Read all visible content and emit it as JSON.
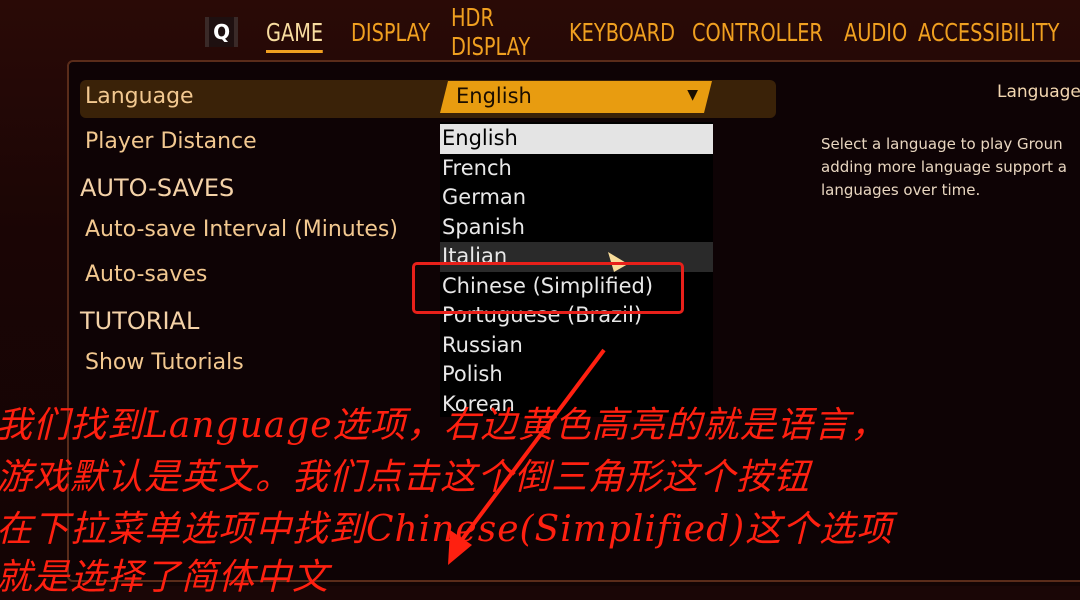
{
  "tabs": {
    "hotkey": "Q",
    "items": [
      "GAME",
      "DISPLAY",
      "HDR DISPLAY",
      "KEYBOARD",
      "CONTROLLER",
      "AUDIO",
      "ACCESSIBILITY"
    ],
    "active": "GAME"
  },
  "settings": {
    "language_label": "Language",
    "player_distance": "Player Distance",
    "autosaves_section": "AUTO-SAVES",
    "autosave_interval": "Auto-save Interval (Minutes)",
    "autosaves": "Auto-saves",
    "tutorial_section": "TUTORIAL",
    "show_tutorials": "Show Tutorials"
  },
  "language_dropdown": {
    "selected": "English",
    "arrow": "▼",
    "options": [
      "English",
      "French",
      "German",
      "Spanish",
      "Italian",
      "Chinese (Simplified)",
      "Portuguese (Brazil)",
      "Russian",
      "Polish",
      "Korean"
    ],
    "hovered": "Italian",
    "highlighted_by_annotation": "Chinese (Simplified)"
  },
  "help": {
    "title": "Language",
    "text": "Select a language to play Groun\nadding more language support a\nlanguages over time."
  },
  "annotation": {
    "color": "#ff2010",
    "lines": [
      "我们找到Language选项，右边黄色高亮的就是语言，",
      "游戏默认是英文。我们点击这个倒三角形这个按钮",
      "在下拉菜单选项中找到Chinese(Simplified)这个选项",
      "就是选择了简体中文"
    ]
  },
  "colors": {
    "accent": "#f0a020",
    "dropdown": "#e89c10",
    "row_highlight": "#3a2208"
  }
}
